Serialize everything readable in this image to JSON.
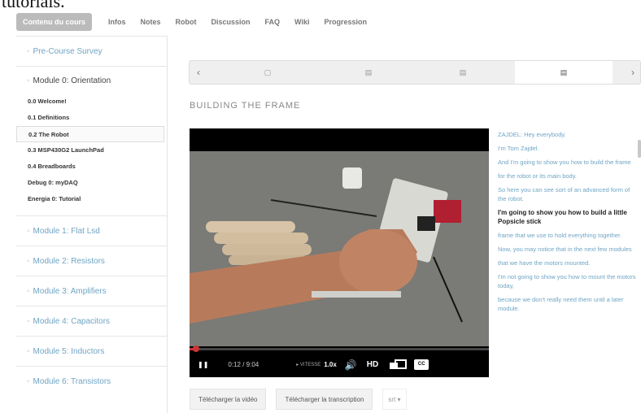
{
  "page": {
    "overflow_text": "tutorials."
  },
  "nav": {
    "tabs": [
      {
        "label": "Contenu du cours"
      },
      {
        "label": "Infos"
      },
      {
        "label": "Notes"
      },
      {
        "label": "Robot"
      },
      {
        "label": "Discussion"
      },
      {
        "label": "FAQ"
      },
      {
        "label": "Wiki"
      },
      {
        "label": "Progression"
      }
    ]
  },
  "sidebar": {
    "pre_survey": "Pre-Course Survey",
    "current_module": "Module 0: Orientation",
    "subsections": [
      "0.0 Welcome!",
      "0.1 Definitions",
      "0.2 The Robot",
      "0.3 MSP430G2 LaunchPad",
      "0.4 Breadboards",
      "Debug 0: myDAQ",
      "Energia 0: Tutorial"
    ],
    "modules": [
      "Module 1: Flat Lsd",
      "Module 2: Resistors",
      "Module 3: Amplifiers",
      "Module 4: Capacitors",
      "Module 5: Inductors",
      "Module 6: Transistors"
    ]
  },
  "sequence": {
    "prev_icon": "chevron-left",
    "next_icon": "chevron-right",
    "items": [
      {
        "icon": "page-icon",
        "glyph": "▢"
      },
      {
        "icon": "video-icon",
        "glyph": "▤"
      },
      {
        "icon": "video-icon",
        "glyph": "▤"
      },
      {
        "icon": "video-icon",
        "glyph": "▤"
      }
    ],
    "active_index": 3
  },
  "unit": {
    "title": "BUILDING THE FRAME"
  },
  "video": {
    "time": "0:12 / 9:04",
    "speed_label": "VITESSE",
    "speed_value": "1.0x",
    "hd_label": "HD",
    "cc_label": "CC",
    "progress": 0.022
  },
  "transcript": {
    "lines": [
      "ZAJDEL: Hey everybody.",
      "I'm Tom Zajdel.",
      "And I'm going to show you how to build the frame",
      "for the robot or its main body.",
      "So here you can see sort of an advanced form of the robot.",
      "I'm going to show you how to build a little Popsicle stick",
      "frame that we use to hold everything together.",
      "Now, you may notice that in the next few modules",
      "that we have the motors mounted.",
      "I'm not going to show you how to mount the motors today,",
      "because we don't really need them until a later module."
    ],
    "current_index": 5
  },
  "downloads": {
    "video": "Télécharger la vidéo",
    "transcript": "Télécharger la transcription",
    "format": "srt ▾"
  },
  "colors": {
    "link": "#6fa5c4",
    "accent": "#cc3333"
  }
}
